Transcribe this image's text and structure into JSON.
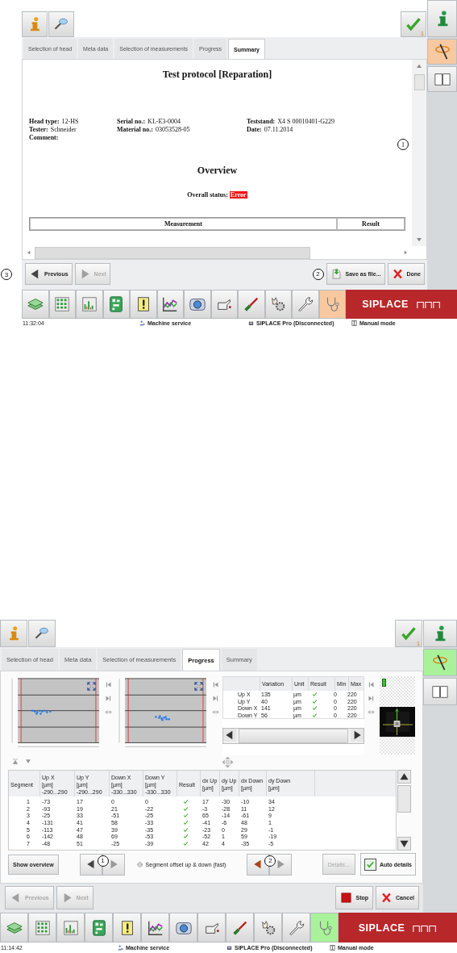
{
  "screens": [
    {
      "kind": "summary",
      "color": "#f8c9a1",
      "check_count": "1",
      "sidebar": [
        {
          "kind": "info",
          "selected": false
        },
        {
          "kind": "wand",
          "selected": true
        },
        {
          "kind": "book",
          "selected": false
        }
      ],
      "tabs": [
        {
          "label": "Selection of head",
          "selected": false
        },
        {
          "label": "Meta data",
          "selected": false
        },
        {
          "label": "Selection of measurements",
          "selected": false
        },
        {
          "label": "Progress",
          "selected": false
        },
        {
          "label": "Summary",
          "selected": true
        }
      ],
      "document": {
        "title": "Test protocol [Reparation]",
        "fields": [
          {
            "label": "Head type:",
            "value": "12-HS"
          },
          {
            "label": "Serial no.:",
            "value": "KL-E3-0004"
          },
          {
            "label": "Teststand:",
            "value": "X4 S 00010401-G229"
          },
          {
            "label": "Tester:",
            "value": "Schneider"
          },
          {
            "label": "Material no.:",
            "value": "03053528-05"
          },
          {
            "label": "Date:",
            "value": "07.11.2014"
          },
          {
            "label": "Comment:"
          }
        ],
        "callout": "1",
        "overview": "Overview",
        "status_label": "Overall status:",
        "status_value": "Error",
        "table_columns": [
          "Measurement",
          "Result"
        ]
      },
      "nav_callout": "3",
      "save_callout": "2",
      "nav_left": [
        {
          "kind": "previous",
          "label": "Previous",
          "disabled": false
        },
        {
          "kind": "next",
          "label": "Next",
          "disabled": true
        }
      ],
      "nav_right": [
        {
          "kind": "save",
          "label": "Save as file...",
          "disabled": false
        },
        {
          "kind": "cancel",
          "label": "Done",
          "disabled": false
        }
      ],
      "taskbar": [
        {
          "kind": "money",
          "selected": false
        },
        {
          "kind": "grid",
          "selected": false
        },
        {
          "kind": "bars",
          "selected": false
        },
        {
          "kind": "board",
          "selected": false
        },
        {
          "kind": "warning",
          "selected": false
        },
        {
          "kind": "linechart",
          "selected": false
        },
        {
          "kind": "camera",
          "selected": false
        },
        {
          "kind": "oilcan",
          "selected": false
        },
        {
          "kind": "screwdriver",
          "selected": false
        },
        {
          "kind": "handgear",
          "selected": false
        },
        {
          "kind": "wrench",
          "selected": false
        },
        {
          "kind": "stethoscope",
          "selected": true
        }
      ],
      "logo": "SIPLACE",
      "status_bar": {
        "time": "11:32:04",
        "user": "Machine service",
        "connection": "SIPLACE Pro (Disconnected)",
        "mode": "Manual mode"
      }
    },
    {
      "kind": "progress",
      "color": "#a9f29a",
      "check_count": "1",
      "sidebar": [
        {
          "kind": "info",
          "selected": false
        },
        {
          "kind": "wand",
          "selected": true
        },
        {
          "kind": "book",
          "selected": false
        }
      ],
      "tabs": [
        {
          "label": "Selection of head",
          "selected": false
        },
        {
          "label": "Meta data",
          "selected": false
        },
        {
          "label": "Selection of measurements",
          "selected": false
        },
        {
          "label": "Progress",
          "selected": true
        },
        {
          "label": "Summary",
          "selected": false
        }
      ],
      "variation": {
        "columns": [
          "Variation",
          "Unit",
          "Result",
          "Min",
          "Max"
        ],
        "rows": [
          {
            "name": "Up X",
            "variation": "135",
            "unit": "µm",
            "ok": true,
            "min": "0",
            "max": "220"
          },
          {
            "name": "Up Y",
            "variation": "40",
            "unit": "µm",
            "ok": true,
            "min": "0",
            "max": "220"
          },
          {
            "name": "Down X",
            "variation": "141",
            "unit": "µm",
            "ok": true,
            "min": "0",
            "max": "220"
          },
          {
            "name": "Down Y",
            "variation": "56",
            "unit": "µm",
            "ok": true,
            "min": "0",
            "max": "220"
          }
        ]
      },
      "segments": {
        "columns": [
          "Segment",
          "Up X\n[µm]\n-290...290",
          "Up Y\n[µm]\n-290...290",
          "Down X\n[µm]\n-330...330",
          "Down Y\n[µm]\n-330...330",
          "Result",
          "dx Up\n[µm]",
          "dy Up\n[µm]",
          "dx Down\n[µm]",
          "dy Down\n[µm]"
        ],
        "rows": [
          {
            "values": [
              "1",
              "-73",
              "17",
              "0",
              "0"
            ],
            "ok": true,
            "deltas": [
              "17",
              "-30",
              "-10",
              "34"
            ]
          },
          {
            "values": [
              "2",
              "-93",
              "19",
              "21",
              "-22"
            ],
            "ok": true,
            "deltas": [
              "-3",
              "-28",
              "11",
              "12"
            ]
          },
          {
            "values": [
              "3",
              "-25",
              "33",
              "-51",
              "-25"
            ],
            "ok": true,
            "deltas": [
              "65",
              "-14",
              "-61",
              "9"
            ]
          },
          {
            "values": [
              "4",
              "-131",
              "41",
              "58",
              "-33"
            ],
            "ok": true,
            "deltas": [
              "-41",
              "-6",
              "48",
              "1"
            ]
          },
          {
            "values": [
              "5",
              "-113",
              "47",
              "39",
              "-35"
            ],
            "ok": true,
            "deltas": [
              "-23",
              "0",
              "29",
              "-1"
            ]
          },
          {
            "values": [
              "6",
              "-142",
              "48",
              "69",
              "-53"
            ],
            "ok": true,
            "deltas": [
              "-52",
              "1",
              "59",
              "-19"
            ]
          },
          {
            "values": [
              "7",
              "-48",
              "51",
              "-25",
              "-39"
            ],
            "ok": true,
            "deltas": [
              "42",
              "4",
              "-35",
              "-5"
            ]
          }
        ]
      },
      "controls": {
        "show_overview": "Show overview",
        "step_callouts": [
          "1",
          "2"
        ],
        "measurement": "Segment offset up & down (fast)",
        "details": {
          "label": "Details...",
          "disabled": true
        },
        "auto_details": {
          "label": "Auto details",
          "checked": true
        }
      },
      "nav_left": [
        {
          "kind": "previous",
          "label": "Previous",
          "disabled": true
        },
        {
          "kind": "next",
          "label": "Next",
          "disabled": true
        }
      ],
      "nav_right": [
        {
          "kind": "stop",
          "label": "Stop",
          "disabled": false
        },
        {
          "kind": "cancel",
          "label": "Cancel",
          "disabled": false
        }
      ],
      "taskbar": [
        {
          "kind": "money",
          "selected": false
        },
        {
          "kind": "grid",
          "selected": false
        },
        {
          "kind": "bars",
          "selected": false
        },
        {
          "kind": "board",
          "selected": false
        },
        {
          "kind": "warning",
          "selected": false
        },
        {
          "kind": "linechart",
          "selected": false
        },
        {
          "kind": "camera",
          "selected": false
        },
        {
          "kind": "oilcan",
          "selected": false
        },
        {
          "kind": "screwdriver",
          "selected": false
        },
        {
          "kind": "handgear",
          "selected": false
        },
        {
          "kind": "wrench",
          "selected": false
        },
        {
          "kind": "stethoscope",
          "selected": true
        }
      ],
      "logo": "SIPLACE",
      "status_bar": {
        "time": "11:14:42",
        "user": "Machine service",
        "connection": "SIPLACE Pro (Disconnected)",
        "mode": "Manual mode"
      }
    }
  ]
}
